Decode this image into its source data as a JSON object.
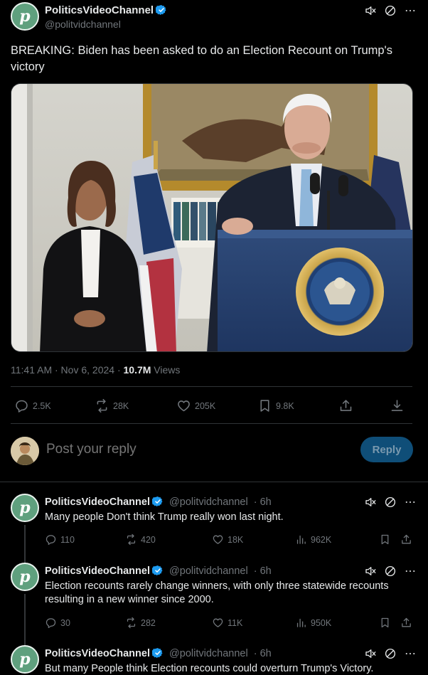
{
  "main_tweet": {
    "display_name": "PoliticsVideoChannel",
    "handle": "@politvidchannel",
    "text": "BREAKING: Biden has been asked to do an Election Recount on Trump's victory",
    "time": "11:41 AM · Nov 6, 2024 · ",
    "views_count": "10.7M",
    "views_label": " Views",
    "stats": {
      "replies": "2.5K",
      "reposts": "28K",
      "likes": "205K",
      "bookmarks": "9.8K"
    }
  },
  "reply_composer": {
    "placeholder": "Post your reply",
    "button": "Reply"
  },
  "thread": [
    {
      "display_name": "PoliticsVideoChannel",
      "handle": "@politvidchannel",
      "age": "· 6h",
      "text": "Many people Don't think Trump really won last night.",
      "replies": "110",
      "reposts": "420",
      "likes": "18K",
      "views": "962K"
    },
    {
      "display_name": "PoliticsVideoChannel",
      "handle": "@politvidchannel",
      "age": "· 6h",
      "text": "Election recounts rarely change winners, with only three statewide recounts resulting in a new winner since 2000.",
      "replies": "30",
      "reposts": "282",
      "likes": "11K",
      "views": "950K"
    },
    {
      "display_name": "PoliticsVideoChannel",
      "handle": "@politvidchannel",
      "age": "· 6h",
      "text": "But many People think Election recounts could overturn Trump's Victory."
    }
  ],
  "icons": {
    "mute": "mute-icon",
    "block": "block-icon",
    "more": "more-icon",
    "verified": "verified-badge-icon",
    "reply": "reply-icon",
    "repost": "repost-icon",
    "like": "like-icon",
    "bookmark": "bookmark-icon",
    "share": "share-icon",
    "download": "download-icon",
    "views": "views-icon"
  },
  "colors": {
    "background": "#000000",
    "text": "#e7e9ea",
    "muted": "#71767b",
    "accent": "#1d9bf0",
    "avatar": "#5fa07e",
    "reply_button": "#0f4e78"
  }
}
